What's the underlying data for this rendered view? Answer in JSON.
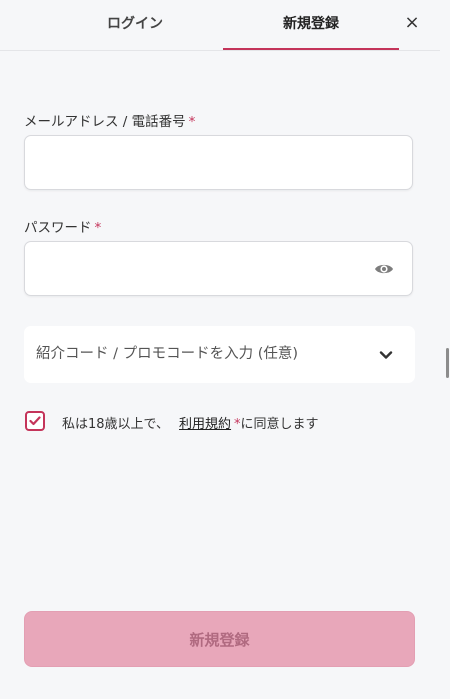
{
  "tabs": {
    "login_label": "ログイン",
    "register_label": "新規登録",
    "close_label": "×"
  },
  "form": {
    "email_label": "メールアドレス / 電話番号",
    "email_value": "",
    "password_label": "パスワード",
    "password_value": "",
    "required_mark": "*",
    "promo_label": "紹介コード / プロモコードを入力 (任意)",
    "consent_prefix": "私は18歳以上で、",
    "terms_link": "利用規約",
    "consent_suffix": "に同意します",
    "submit_label": "新規登録"
  },
  "colors": {
    "accent": "#c4345a",
    "submit_bg": "#e8a7ba",
    "page_bg": "#f6f7f9"
  },
  "icons": {
    "close": "close-icon",
    "password_toggle": "eye-icon",
    "promo_expand": "chevron-down-icon",
    "consent": "checkmark-icon"
  }
}
